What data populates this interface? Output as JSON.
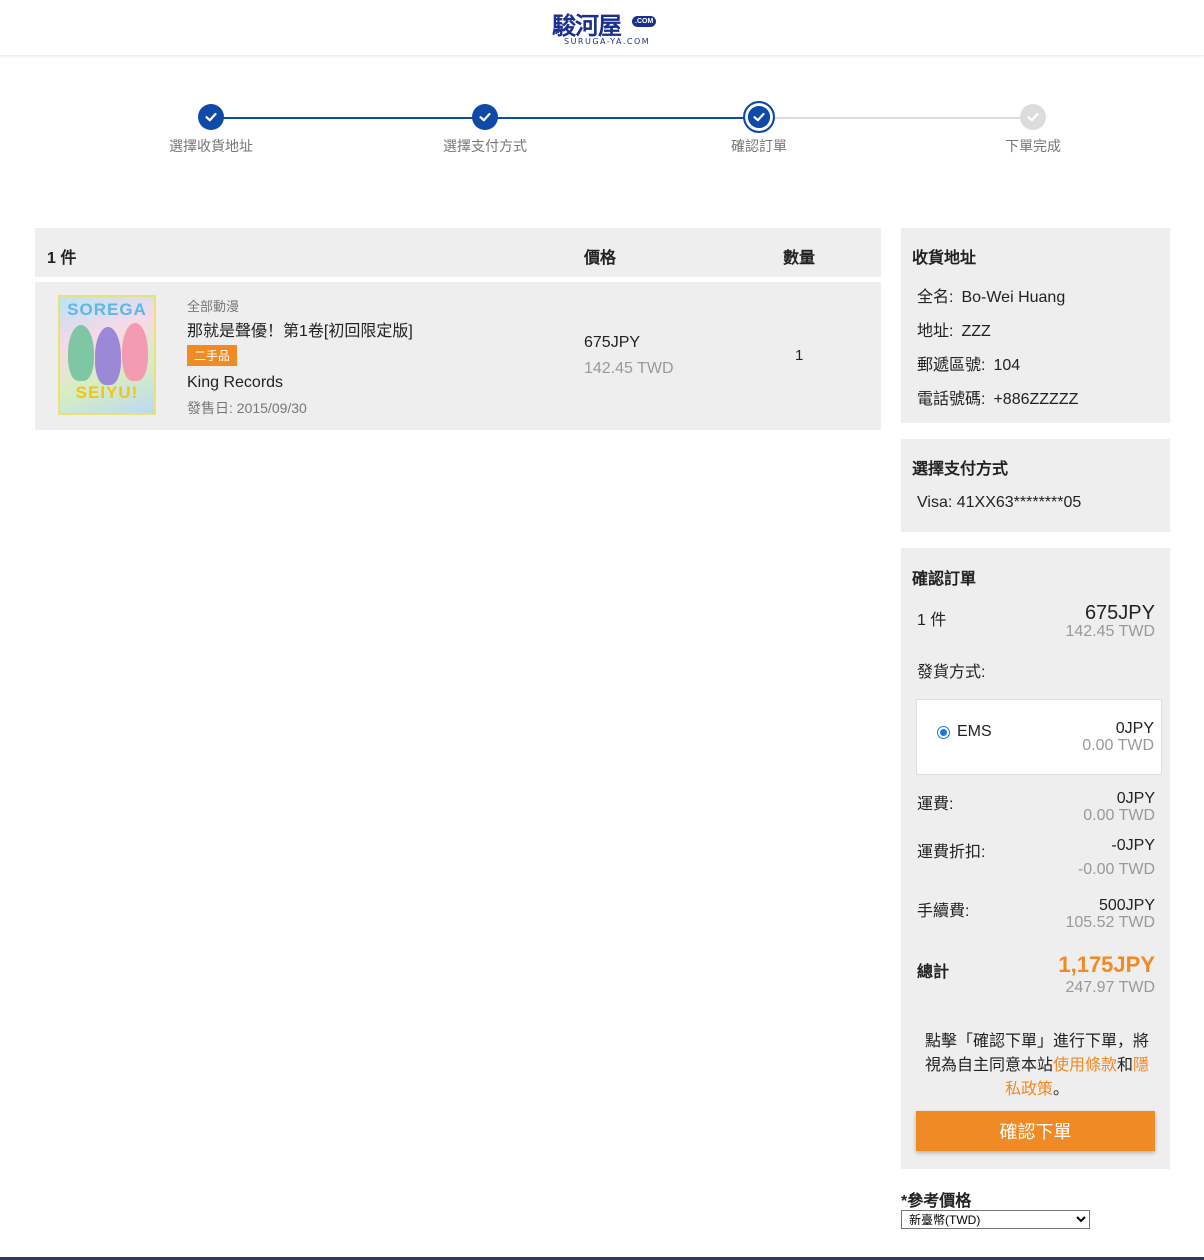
{
  "header": {
    "logo_text": "駿河屋",
    "logo_com": ".COM",
    "logo_sub": "SURUGA-YA.COM"
  },
  "steps": [
    {
      "label": "選擇收貨地址",
      "state": "done"
    },
    {
      "label": "選擇支付方式",
      "state": "done"
    },
    {
      "label": "確認訂單",
      "state": "current"
    },
    {
      "label": "下單完成",
      "state": "todo"
    }
  ],
  "cart": {
    "count_label": "1 件",
    "price_header": "價格",
    "qty_header": "數量",
    "item": {
      "cover_text_top": "SOREGA",
      "cover_text_bottom": "SEIYU!",
      "category": "全部動漫",
      "name": "那就是聲優！第1卷[初回限定版]",
      "condition_badge": "二手品",
      "maker": "King Records",
      "release": "發售日: 2015/09/30",
      "price_jpy": "675JPY",
      "price_twd": "142.45 TWD",
      "qty": "1"
    }
  },
  "address": {
    "title": "收貨地址",
    "name_label": "全名:",
    "name_value": "Bo-Wei Huang",
    "addr_label": "地址:",
    "addr_value": "ZZZ",
    "zip_label": "郵遞區號:",
    "zip_value": "104",
    "phone_label": "電話號碼:",
    "phone_value": "+886ZZZZZ"
  },
  "payment": {
    "title": "選擇支付方式",
    "card": "Visa: 41XX63********05"
  },
  "order": {
    "title": "確認訂單",
    "count": "1 件",
    "subtotal_jpy": "675JPY",
    "subtotal_twd": "142.45 TWD",
    "shipping_method_label": "發貨方式:",
    "ems_label": "EMS",
    "ems_jpy": "0JPY",
    "ems_twd": "0.00 TWD",
    "freight_label": "運費:",
    "freight_jpy": "0JPY",
    "freight_twd": "0.00 TWD",
    "discount_label": "運費折扣:",
    "discount_jpy": "-0JPY",
    "discount_twd": "-0.00 TWD",
    "fee_label": "手續費:",
    "fee_jpy": "500JPY",
    "fee_twd": "105.52 TWD",
    "total_label": "總計",
    "total_jpy": "1,175JPY",
    "total_twd": "247.97 TWD",
    "notice_before": "點擊「確認下單」進行下單，將視為自主同意本站",
    "terms_link": "使用條款",
    "notice_and": "和",
    "privacy_link": "隱私政策",
    "notice_end": "。",
    "confirm_button": "確認下單"
  },
  "reference": {
    "title": "*參考價格",
    "selected_currency": "新臺幣(TWD)"
  },
  "colors": {
    "primary_blue": "#0f4aa8",
    "accent_orange": "#f08a24",
    "panel_grey": "#eeeeee"
  }
}
